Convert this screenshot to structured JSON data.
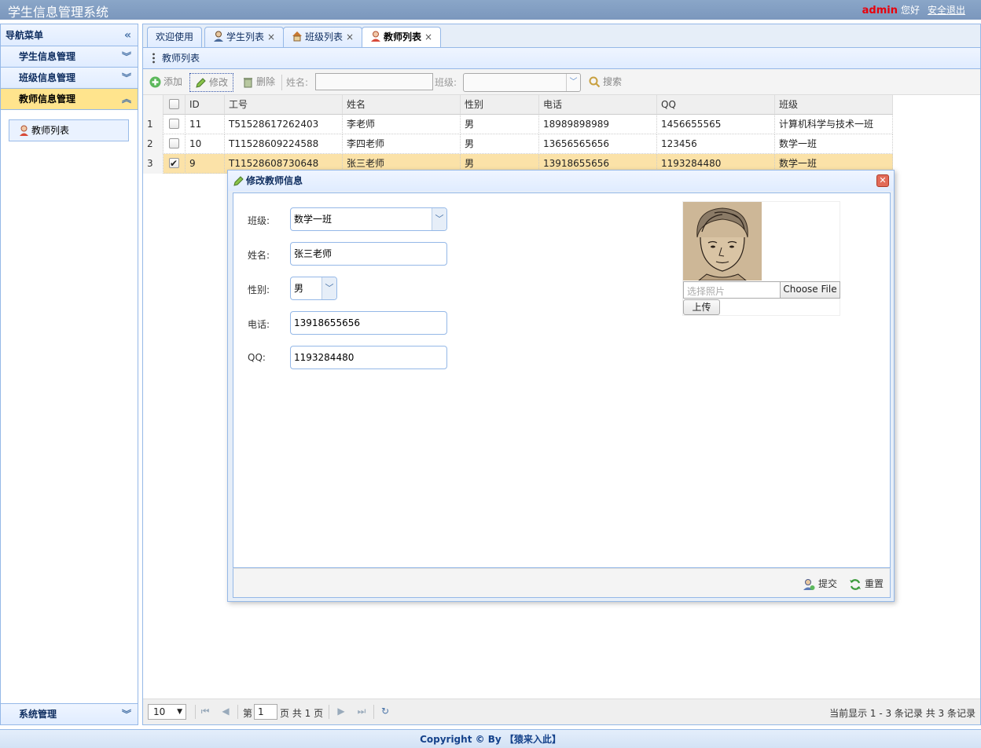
{
  "header": {
    "title": "学生信息管理系统",
    "user": "admin",
    "greeting": "您好",
    "logout": "安全退出"
  },
  "nav": {
    "title": "导航菜单",
    "panels": [
      {
        "label": "学生信息管理"
      },
      {
        "label": "班级信息管理"
      },
      {
        "label": "教师信息管理"
      }
    ],
    "sub_item": "教师列表",
    "system": "系统管理"
  },
  "tabs": [
    {
      "label": "欢迎使用",
      "closable": false
    },
    {
      "label": "学生列表",
      "closable": true
    },
    {
      "label": "班级列表",
      "closable": true
    },
    {
      "label": "教师列表",
      "closable": true
    }
  ],
  "close_glyph": "×",
  "panel": {
    "title": "教师列表"
  },
  "toolbar": {
    "add": "添加",
    "edit": "修改",
    "delete": "删除",
    "name_label": "姓名:",
    "class_label": "班级:",
    "search": "搜索"
  },
  "grid": {
    "columns": [
      "ID",
      "工号",
      "姓名",
      "性别",
      "电话",
      "QQ",
      "班级"
    ],
    "rows": [
      {
        "num": "1",
        "checked": false,
        "cells": [
          "11",
          "T51528617262403",
          "李老师",
          "男",
          "18989898989",
          "1456655565",
          "计算机科学与技术一班"
        ]
      },
      {
        "num": "2",
        "checked": false,
        "cells": [
          "10",
          "T11528609224588",
          "李四老师",
          "男",
          "13656565656",
          "123456",
          "数学一班"
        ]
      },
      {
        "num": "3",
        "checked": true,
        "cells": [
          "9",
          "T11528608730648",
          "张三老师",
          "男",
          "13918655656",
          "1193284480",
          "数学一班"
        ]
      }
    ]
  },
  "pager": {
    "page_size": "10",
    "page_prefix": "第",
    "page_value": "1",
    "page_suffix": "页 共 1 页",
    "info": "当前显示 1 - 3 条记录 共 3 条记录"
  },
  "dialog": {
    "title": "修改教师信息",
    "class_label": "班级:",
    "class_value": "数学一班",
    "name_label": "姓名:",
    "name_value": "张三老师",
    "sex_label": "性别:",
    "sex_value": "男",
    "phone_label": "电话:",
    "phone_value": "13918655656",
    "qq_label": "QQ:",
    "qq_value": "1193284480",
    "photo_placeholder": "选择照片",
    "choose_file": "Choose File",
    "upload": "上传",
    "submit": "提交",
    "reset": "重置"
  },
  "footer": "Copyright © By 【猿来入此】",
  "colors": {
    "accent": "#95b8e7",
    "active_nav": "#ffe48d",
    "selected_row": "#fbe2a8",
    "user": "#e8000b"
  }
}
